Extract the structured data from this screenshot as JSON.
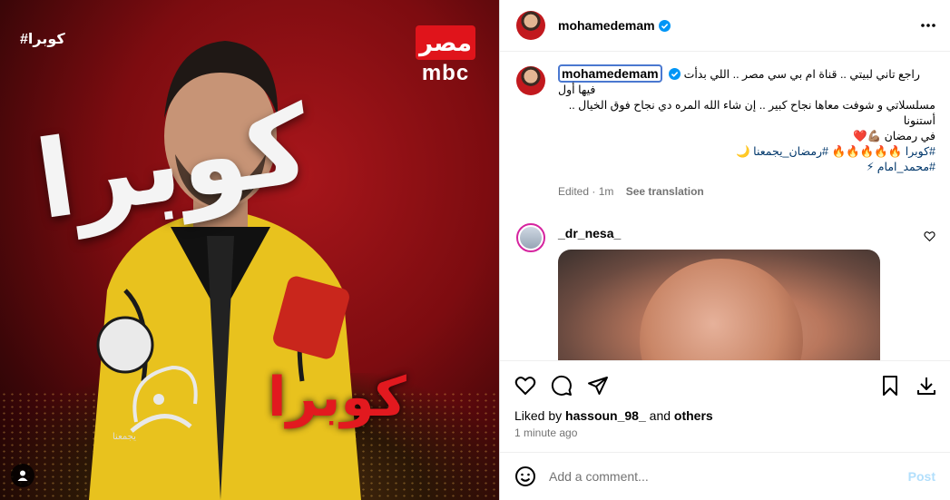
{
  "media": {
    "hashtag": "#كوبرا",
    "channel_ar": "مصر",
    "channel_en": "mbc",
    "title_big": "كوبرا",
    "title_red": "كوبرا",
    "ramadan_sub": "يجمعنا"
  },
  "header": {
    "username": "mohamedemam",
    "verified": true
  },
  "caption": {
    "username": "mohamedemam",
    "line1": "راجع تاني لبيتي .. قناة ام بي سي مصر .. اللي بدأت فيها أول",
    "line2": "مسلسلاتي و شوفت معاها نجاح كبير .. إن شاء الله المره دي نجاح فوق الخيال .. أستنونا",
    "line3": "في رمضان 💪🏽❤️",
    "tags1": "#كوبرا 🔥🔥🔥🔥🔥 #رمضان_يجمعنا 🌙",
    "tags2": "#محمد_امام ⚡",
    "edited": "Edited · 1m",
    "translate": "See translation"
  },
  "comment": {
    "username": "_dr_nesa_"
  },
  "likes": {
    "prefix": "Liked by",
    "user": "hassoun_98_",
    "and": "and",
    "others": "others",
    "time": "1 minute ago"
  },
  "composer": {
    "placeholder": "Add a comment...",
    "post": "Post"
  },
  "colors": {
    "verified": "#0095f6",
    "tag": "#00376b",
    "post_disabled": "#b2dffc",
    "story_ring": "#d6249f"
  }
}
